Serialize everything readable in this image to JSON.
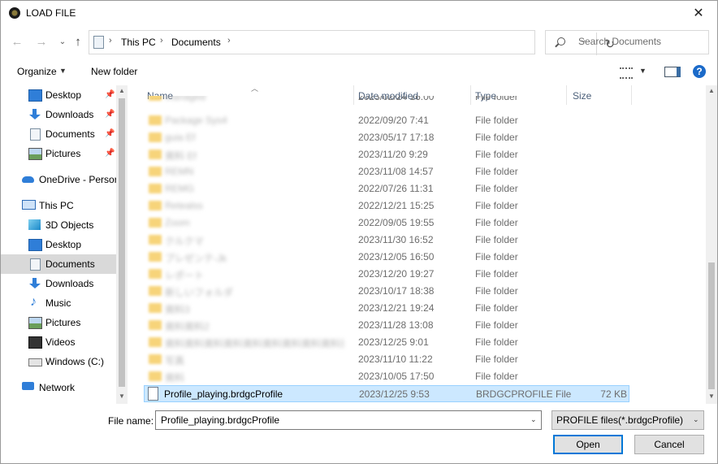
{
  "window": {
    "title": "LOAD FILE"
  },
  "address": {
    "crumbs": [
      "This PC",
      "Documents"
    ]
  },
  "search": {
    "placeholder": "Search Documents"
  },
  "toolbar": {
    "organize_label": "Organize",
    "new_folder_label": "New folder"
  },
  "nav": {
    "items": [
      {
        "label": "Desktop",
        "icon": "desktop-icon",
        "pinned": true
      },
      {
        "label": "Downloads",
        "icon": "downloads-icon",
        "pinned": true
      },
      {
        "label": "Documents",
        "icon": "documents-icon",
        "pinned": true
      },
      {
        "label": "Pictures",
        "icon": "pictures-icon",
        "pinned": true
      },
      {
        "label": "OneDrive - Persor",
        "icon": "onedrive-icon"
      },
      {
        "label": "This PC",
        "icon": "this-pc-icon"
      },
      {
        "label": "3D Objects",
        "icon": "3d-objects-icon"
      },
      {
        "label": "Desktop",
        "icon": "desktop-icon"
      },
      {
        "label": "Documents",
        "icon": "documents-icon",
        "selected": true
      },
      {
        "label": "Downloads",
        "icon": "downloads-icon"
      },
      {
        "label": "Music",
        "icon": "music-icon"
      },
      {
        "label": "Pictures",
        "icon": "pictures-icon"
      },
      {
        "label": "Videos",
        "icon": "videos-icon"
      },
      {
        "label": "Windows (C:)",
        "icon": "drive-icon"
      },
      {
        "label": "Network",
        "icon": "network-icon"
      }
    ]
  },
  "columns": {
    "name": "Name",
    "date": "Date modified",
    "type": "Type",
    "size": "Size"
  },
  "files": [
    {
      "name": "Managed",
      "date": "2023/02/24 16:00",
      "type": "File folder",
      "size": ""
    },
    {
      "name": "Package Sys4",
      "date": "2022/09/20 7:41",
      "type": "File folder",
      "size": ""
    },
    {
      "name": "guia Ef",
      "date": "2023/05/17 17:18",
      "type": "File folder",
      "size": ""
    },
    {
      "name": "資料 Ef",
      "date": "2023/11/20 9:29",
      "type": "File folder",
      "size": ""
    },
    {
      "name": "REMN",
      "date": "2023/11/08 14:57",
      "type": "File folder",
      "size": ""
    },
    {
      "name": "REMG",
      "date": "2022/07/26 11:31",
      "type": "File folder",
      "size": ""
    },
    {
      "name": "Retealss",
      "date": "2022/12/21 15:25",
      "type": "File folder",
      "size": ""
    },
    {
      "name": "Zoom",
      "date": "2022/09/05 19:55",
      "type": "File folder",
      "size": ""
    },
    {
      "name": "クルクマ",
      "date": "2023/11/30 16:52",
      "type": "File folder",
      "size": ""
    },
    {
      "name": "プレゼンテ-Jk",
      "date": "2023/12/05 16:50",
      "type": "File folder",
      "size": ""
    },
    {
      "name": "レポート",
      "date": "2023/12/20 19:27",
      "type": "File folder",
      "size": ""
    },
    {
      "name": "新しいフォルダ",
      "date": "2023/10/17 18:38",
      "type": "File folder",
      "size": ""
    },
    {
      "name": "資料3",
      "date": "2023/12/21 19:24",
      "type": "File folder",
      "size": ""
    },
    {
      "name": "資料資料2",
      "date": "2023/11/28 13:08",
      "type": "File folder",
      "size": ""
    },
    {
      "name": "資料資料資料資料資料資料資料資料資料資料資料",
      "date": "2023/12/25 9:01",
      "type": "File folder",
      "size": ""
    },
    {
      "name": "写真",
      "date": "2023/11/10 11:22",
      "type": "File folder",
      "size": ""
    },
    {
      "name": "資料",
      "date": "2023/10/05 17:50",
      "type": "File folder",
      "size": ""
    },
    {
      "name": "Profile_playing.brdgcProfile",
      "date": "2023/12/25 9:53",
      "type": "BRDGCPROFILE File",
      "size": "72 KB",
      "selected": true
    }
  ],
  "bottom": {
    "file_name_label": "File name:",
    "file_name_value": "Profile_playing.brdgcProfile",
    "filter_value": "PROFILE files(*.brdgcProfile)",
    "open_label": "Open",
    "cancel_label": "Cancel"
  }
}
